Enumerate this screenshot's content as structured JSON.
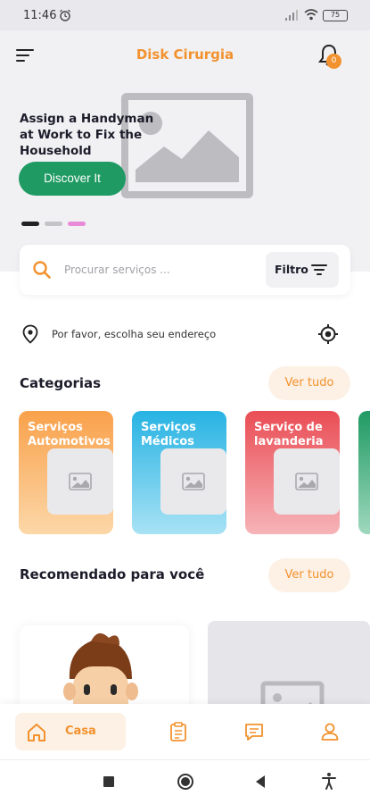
{
  "status_bar": {
    "time": "11:46",
    "battery": "75"
  },
  "header": {
    "title": "Disk Cirurgia",
    "notification_count": "0"
  },
  "banner": {
    "text": "Assign a Handyman at Work to Fix the Household",
    "cta_label": "Discover It",
    "dot_colors": [
      "#222222",
      "#c4c4c8",
      "#e88ad8"
    ]
  },
  "search": {
    "placeholder": "Procurar serviços ...",
    "filter_label": "Filtro"
  },
  "location": {
    "prompt": "Por favor, escolha seu endereço"
  },
  "categories": {
    "title": "Categorias",
    "see_all": "Ver tudo",
    "items": [
      {
        "label": "Serviços Automotivos"
      },
      {
        "label": "Serviços Médicos"
      },
      {
        "label": "Serviço de lavanderia"
      }
    ]
  },
  "recommended": {
    "title": "Recomendado para você",
    "see_all": "Ver tudo"
  },
  "bottom_nav": {
    "home_label": "Casa"
  },
  "colors": {
    "accent": "#f2922e",
    "primary_button": "#1f9a63"
  }
}
